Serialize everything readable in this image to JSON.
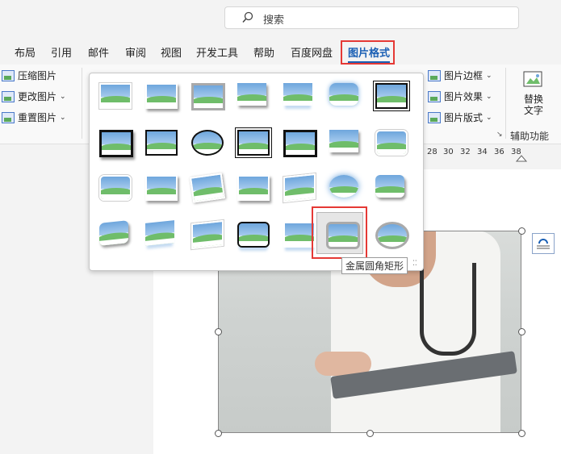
{
  "search": {
    "placeholder": "搜索",
    "icon": "search-icon"
  },
  "tabs": [
    {
      "label": "布局"
    },
    {
      "label": "引用"
    },
    {
      "label": "邮件"
    },
    {
      "label": "审阅"
    },
    {
      "label": "视图"
    },
    {
      "label": "开发工具"
    },
    {
      "label": "帮助"
    },
    {
      "label": "百度网盘"
    },
    {
      "label": "图片格式",
      "active": true
    }
  ],
  "ribbon": {
    "adjust": {
      "compress": "压缩图片",
      "change": "更改图片",
      "reset": "重置图片"
    },
    "picture_styles": {
      "border": "图片边框",
      "effects": "图片效果",
      "layout": "图片版式"
    },
    "accessibility": {
      "alt_text_line1": "替换",
      "alt_text_line2": "文字",
      "group_label": "辅助功能"
    }
  },
  "ruler": {
    "ticks": [
      "28",
      "30",
      "32",
      "34",
      "36",
      "38"
    ]
  },
  "gallery": {
    "selected_tooltip": "金属圆角矩形",
    "styles": [
      "simple-frame-white",
      "beveled-matte-white",
      "metal-frame",
      "drop-shadow-rectangle",
      "reflected-rounded-rectangle",
      "soft-edge-rectangle",
      "double-frame-black",
      "thick-matte-black",
      "simple-frame-black",
      "beveled-oval-black",
      "compound-frame-black",
      "moderate-frame-black",
      "center-shadow-rectangle",
      "rounded-diagonal-corner-white",
      "snip-diagonal-corner-white",
      "moderate-frame-white",
      "rotated-white",
      "perspective-shadow-white",
      "relaxed-perspective-white",
      "soft-edge-oval",
      "bevel-rectangle",
      "bevel-perspective",
      "reflected-perspective-right",
      "bevel-perspective-left-white",
      "reflected-bevel-black",
      "reflected-bevel-white",
      "metal-rounded-rectangle",
      "metal-oval"
    ]
  },
  "colors": {
    "accent": "#1a5fb4",
    "highlight": "#e53935"
  }
}
